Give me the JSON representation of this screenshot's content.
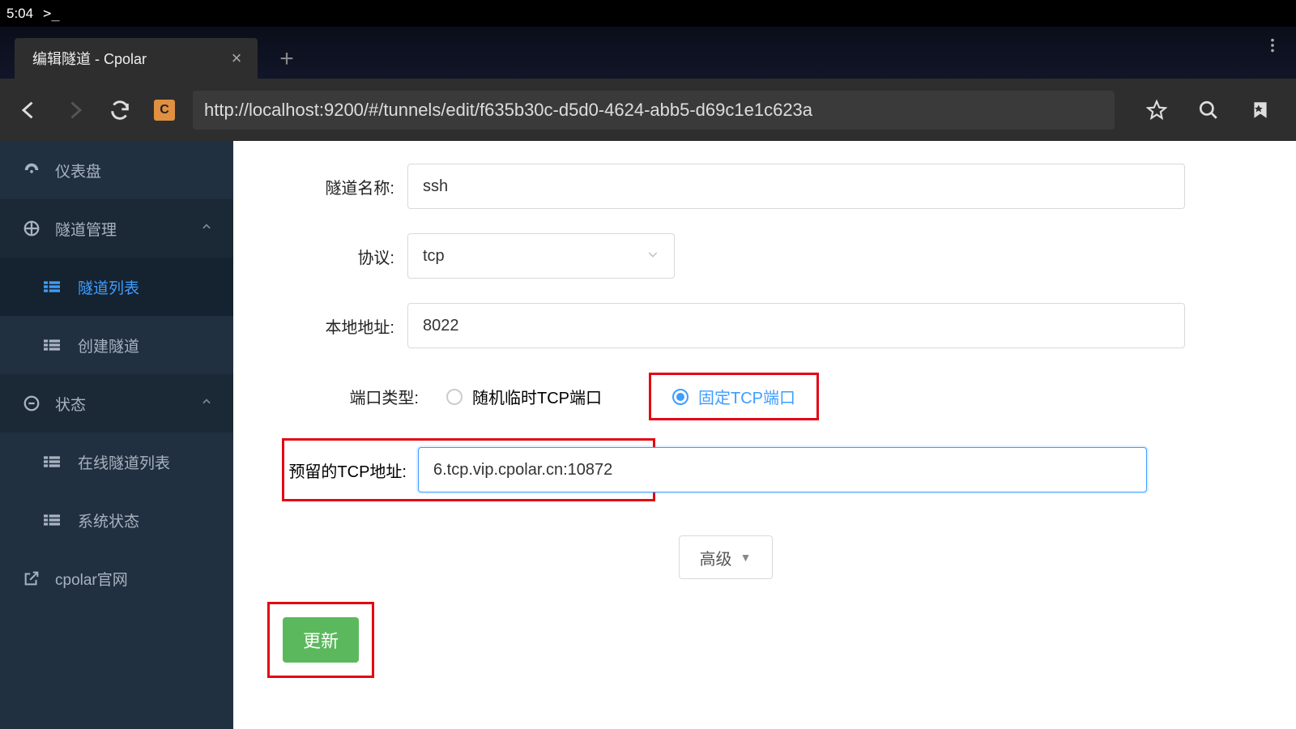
{
  "status_bar": {
    "time": "5:04",
    "prompt": ">_"
  },
  "browser": {
    "tab_title": "编辑隧道 - Cpolar",
    "favicon_letter": "C",
    "url": "http://localhost:9200/#/tunnels/edit/f635b30c-d5d0-4624-abb5-d69c1e1c623a"
  },
  "sidebar": {
    "dashboard": "仪表盘",
    "tunnel_mgmt": "隧道管理",
    "tunnel_list": "隧道列表",
    "create_tunnel": "创建隧道",
    "status": "状态",
    "online_tunnels": "在线隧道列表",
    "system_status": "系统状态",
    "cpolar_site": "cpolar官网"
  },
  "form": {
    "labels": {
      "name": "隧道名称:",
      "protocol": "协议:",
      "local_addr": "本地地址:",
      "port_type": "端口类型:",
      "reserved_tcp": "预留的TCP地址:"
    },
    "values": {
      "name": "ssh",
      "protocol": "tcp",
      "local_addr": "8022",
      "reserved_tcp": "6.tcp.vip.cpolar.cn:10872"
    },
    "port_type_options": {
      "random": "随机临时TCP端口",
      "fixed": "固定TCP端口"
    },
    "advanced_label": "高级",
    "submit_label": "更新"
  }
}
